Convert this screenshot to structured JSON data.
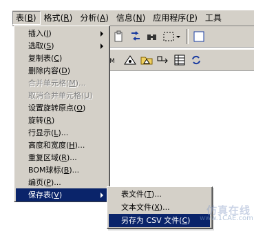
{
  "menubar": {
    "items": [
      {
        "label": "表(",
        "key": "B",
        "suffix": ")"
      },
      {
        "label": "格式(",
        "key": "R",
        "suffix": ")"
      },
      {
        "label": "分析(",
        "key": "A",
        "suffix": ")"
      },
      {
        "label": "信息(",
        "key": "N",
        "suffix": ")"
      },
      {
        "label": "应用程序(",
        "key": "P",
        "suffix": ")"
      },
      {
        "label": "工具",
        "key": "",
        "suffix": ""
      }
    ]
  },
  "menu": {
    "items": [
      {
        "pre": "插入(",
        "key": "I",
        "post": ")",
        "submenu": true,
        "disabled": false
      },
      {
        "pre": "选取(",
        "key": "S",
        "post": ")",
        "submenu": true,
        "disabled": false
      },
      {
        "pre": "复制表(",
        "key": "C",
        "post": ")",
        "submenu": false,
        "disabled": false
      },
      {
        "pre": "删除内容(",
        "key": "D",
        "post": ")",
        "submenu": false,
        "disabled": false
      },
      {
        "pre": "合并单元格(",
        "key": "M",
        "post": ")...",
        "submenu": false,
        "disabled": true
      },
      {
        "pre": "取消合并单元格(",
        "key": "U",
        "post": ")",
        "submenu": false,
        "disabled": true
      },
      {
        "pre": "设置旋转原点(",
        "key": "O",
        "post": ")",
        "submenu": false,
        "disabled": false
      },
      {
        "pre": "旋转(",
        "key": "R",
        "post": ")",
        "submenu": false,
        "disabled": false
      },
      {
        "pre": "行显示(",
        "key": "L",
        "post": ")...",
        "submenu": false,
        "disabled": false
      },
      {
        "pre": "高度和宽度(",
        "key": "H",
        "post": ")...",
        "submenu": false,
        "disabled": false
      },
      {
        "pre": "重复区域(",
        "key": "R",
        "post": ")...",
        "submenu": false,
        "disabled": false
      },
      {
        "pre": "BOM球标(",
        "key": "B",
        "post": ")...",
        "submenu": false,
        "disabled": false
      },
      {
        "pre": "编页(",
        "key": "P",
        "post": ")...",
        "submenu": false,
        "disabled": false
      },
      {
        "pre": "保存表(",
        "key": "V",
        "post": ")",
        "submenu": true,
        "disabled": false,
        "selected": true
      }
    ]
  },
  "submenu": {
    "items": [
      {
        "pre": "表文件(",
        "key": "T",
        "post": ")...",
        "selected": false
      },
      {
        "pre": "文本文件(",
        "key": "X",
        "post": ")...",
        "selected": false
      },
      {
        "pre": "另存为 CSV 文件(",
        "key": "C",
        "post": ")",
        "selected": true
      }
    ]
  },
  "watermark": {
    "line1": "仿真在线",
    "line2": "www.1CAE.com"
  }
}
